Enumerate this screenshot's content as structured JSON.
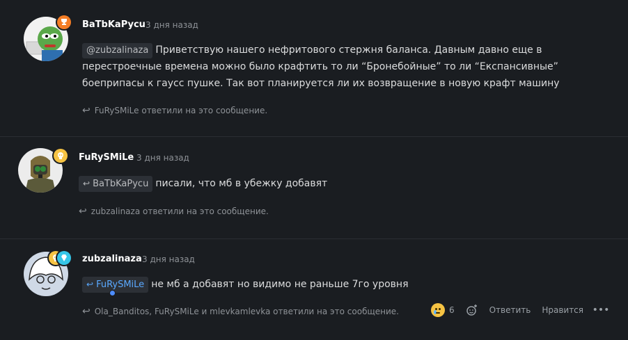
{
  "posts": [
    {
      "username": "BaTbKaPycu",
      "time": "3 дня назад",
      "mention": "@zubzalinaza",
      "text": "Приветствую нашего нефритового стержня баланса. Давным давно еще в перестроечные времена можно было крафтить то ли “Бронебойные” то ли “Експансивные” боеприпасы к гаусс пушке. Так вот планируется ли их возвращение в новую крафт машину",
      "replied": "FuRySMiLe ответили на это сообщение."
    },
    {
      "username": "FuRySMiLe",
      "time": "3 дня назад",
      "mention": "BaTbKaPycu",
      "text": "писали, что мб в убежку добавят",
      "replied": "zubzalinaza ответили на это сообщение."
    },
    {
      "username": "zubzalinaza",
      "time": "3 дня назад",
      "mention": "FuRySMiLe",
      "text": "не мб а добавят но видимо не раньше 7го уровня",
      "replied": "Ola_Banditos, FuRySMiLe и mlevkamlevka ответили на это сообщение."
    }
  ],
  "actions": {
    "reaction_count": "6",
    "reply_label": "Ответить",
    "like_label": "Нравится"
  },
  "icons": {
    "reply_arrow": "reply-arrow-icon",
    "trophy": "trophy-icon",
    "skull": "skull-icon",
    "diamond": "diamond-icon",
    "add_reaction": "add-reaction-icon",
    "more": "more-icon"
  },
  "colors": {
    "background": "#1a1d21",
    "text": "#dcddde",
    "muted": "#8e9297",
    "link_blue": "#5aa9ff",
    "badge_orange": "#f47d25",
    "badge_yellow": "#f6c343",
    "badge_cyan": "#35c6e8"
  }
}
